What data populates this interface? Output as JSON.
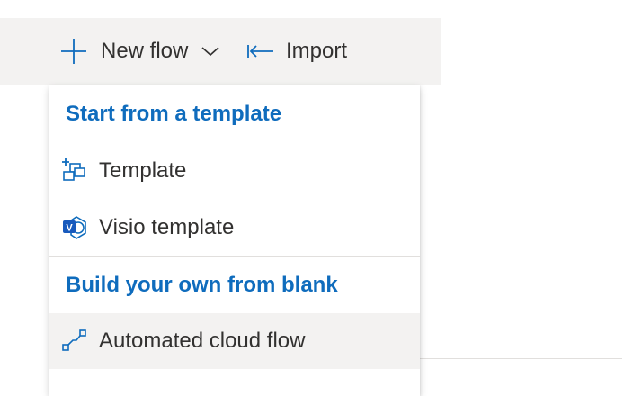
{
  "command_bar": {
    "new_flow_label": "New flow",
    "new_flow_icon": "plus-icon",
    "dropdown_icon": "chevron-down-icon",
    "import_label": "Import",
    "import_icon": "import-arrow-icon"
  },
  "menu": {
    "section_template_header": "Start from a template",
    "items_template": [
      {
        "label": "Template",
        "icon": "template-icon"
      },
      {
        "label": "Visio template",
        "icon": "visio-icon"
      }
    ],
    "section_blank_header": "Build your own from blank",
    "items_blank": [
      {
        "label": "Automated cloud flow",
        "icon": "automated-flow-icon",
        "hovered": true
      }
    ]
  },
  "colors": {
    "accent": "#0f6cbd",
    "text": "#323130",
    "command_bar_bg": "#f3f2f1",
    "hover_bg": "#f3f2f1",
    "visio_brand": "#185abd"
  }
}
